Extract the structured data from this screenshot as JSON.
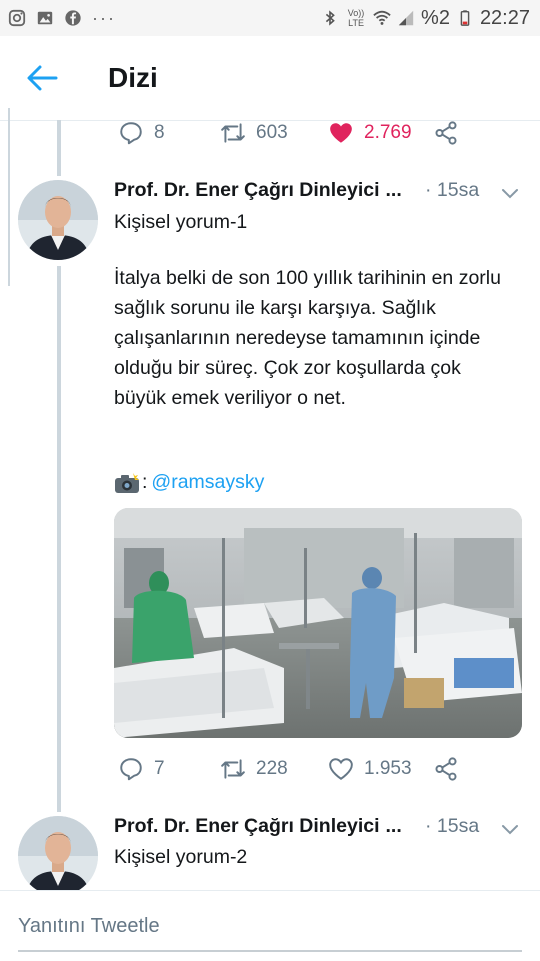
{
  "status_bar": {
    "battery": "%2",
    "time": "22:27",
    "network": "Vo)) LTE",
    "icons": [
      "instagram-icon",
      "gallery-icon",
      "facebook-icon",
      "more-dots-icon",
      "bluetooth-icon",
      "volte-icon",
      "wifi-icon",
      "signal-icon",
      "battery-icon"
    ]
  },
  "header": {
    "title": "Dizi"
  },
  "prev_tweet": {
    "replies": "8",
    "retweets": "603",
    "likes": "2.769",
    "liked": true
  },
  "tweets": [
    {
      "author": "Prof. Dr. Ener Çağrı Dinleyici",
      "ellipsis": "...",
      "separator": "·",
      "time": "15sa",
      "heading": "Kişisel yorum-1",
      "body": "İtalya belki de son 100 yıllık tarihinin en zorlu sağlık sorunu ile karşı karşıya. Sağlık çalışanlarının neredeyse tamamının içinde olduğu bir süreç. Çok zor koşullarda çok büyük emek veriliyor o net.",
      "credit_prefix": ":",
      "mention": "@ramsaysky",
      "replies": "7",
      "retweets": "228",
      "likes": "1.953"
    },
    {
      "author": "Prof. Dr. Ener Çağrı Dinleyici",
      "ellipsis": "...",
      "separator": "·",
      "time": "15sa",
      "heading": "Kişisel yorum-2"
    }
  ],
  "reply_bar": {
    "placeholder": "Yanıtını Tweetle"
  },
  "colors": {
    "accent": "#1da1f2",
    "like": "#e0245e",
    "muted": "#657786"
  }
}
